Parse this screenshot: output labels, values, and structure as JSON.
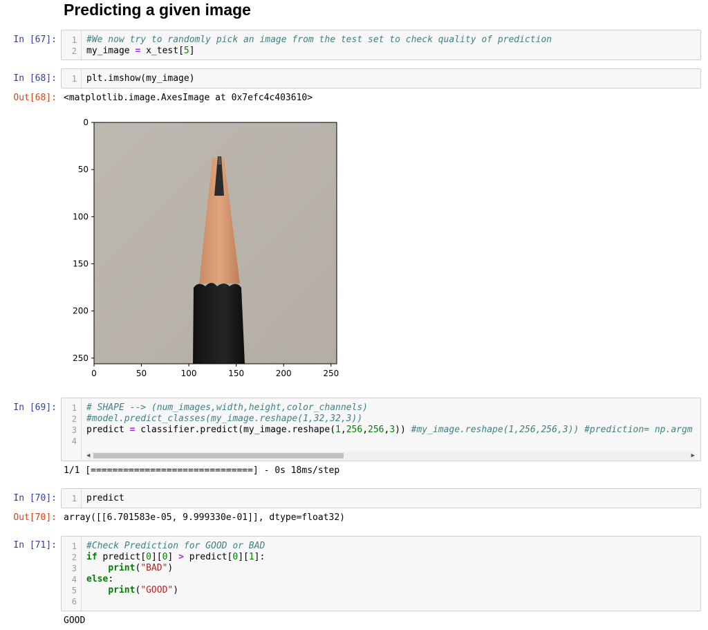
{
  "heading": "Predicting a given image",
  "cells": [
    {
      "prompt": "In [67]:",
      "lines": [
        [
          [
            "cm",
            "#We now try to randomly pick an image from the test set to check quality of prediction"
          ]
        ],
        [
          [
            "",
            "my_image "
          ],
          [
            "op",
            "="
          ],
          [
            "",
            " x_test["
          ],
          [
            "num",
            "5"
          ],
          [
            "",
            "]"
          ]
        ]
      ]
    },
    {
      "prompt": "In [68]:",
      "lines": [
        [
          [
            "",
            "plt.imshow(my_image)"
          ]
        ]
      ]
    },
    {
      "prompt": "In [69]:",
      "lines": [
        [
          [
            "cm",
            "# SHAPE --> (num_images,width,height,color_channels)"
          ]
        ],
        [
          [
            "cm",
            "#model.predict_classes(my_image.reshape(1,32,32,3))"
          ]
        ],
        [
          [
            "",
            "predict "
          ],
          [
            "op",
            "="
          ],
          [
            "",
            " classifier.predict(my_image.reshape("
          ],
          [
            "num",
            "1"
          ],
          [
            "",
            ","
          ],
          [
            "num",
            "256"
          ],
          [
            "",
            ","
          ],
          [
            "num",
            "256"
          ],
          [
            "",
            ","
          ],
          [
            "num",
            "3"
          ],
          [
            "",
            "))"
          ],
          [
            "",
            " "
          ],
          [
            "cm",
            "#my_image.reshape(1,256,256,3)) #prediction= np.argm"
          ]
        ],
        [
          [
            "",
            ""
          ]
        ]
      ]
    },
    {
      "prompt": "In [70]:",
      "lines": [
        [
          [
            "",
            "predict"
          ]
        ]
      ]
    },
    {
      "prompt": "In [71]:",
      "lines": [
        [
          [
            "cm",
            "#Check Prediction for GOOD or BAD"
          ]
        ],
        [
          [
            "kw",
            "if"
          ],
          [
            "",
            " predict["
          ],
          [
            "num",
            "0"
          ],
          [
            "",
            "]["
          ],
          [
            "num",
            "0"
          ],
          [
            "",
            "] "
          ],
          [
            "op",
            ">"
          ],
          [
            "",
            " predict["
          ],
          [
            "num",
            "0"
          ],
          [
            "",
            "]["
          ],
          [
            "num",
            "1"
          ],
          [
            "",
            "]:"
          ]
        ],
        [
          [
            "",
            "    "
          ],
          [
            "kw",
            "print"
          ],
          [
            "",
            "("
          ],
          [
            "str",
            "\"BAD\""
          ],
          [
            "",
            ")"
          ]
        ],
        [
          [
            "kw",
            "else"
          ],
          [
            "",
            ":"
          ]
        ],
        [
          [
            "",
            "    "
          ],
          [
            "kw",
            "print"
          ],
          [
            "",
            "("
          ],
          [
            "str",
            "\"GOOD\""
          ],
          [
            "",
            ")"
          ]
        ],
        [
          [
            "",
            ""
          ]
        ]
      ]
    }
  ],
  "outputs": {
    "out68_prompt": "Out[68]:",
    "out68_text": "<matplotlib.image.AxesImage at 0x7efc4c403610>",
    "out69_text": "1/1 [==============================] - 0s 18ms/step",
    "out70_prompt": "Out[70]:",
    "out70_text": "array([[6.701583e-05, 9.999330e-01]], dtype=float32)",
    "out71_text": "GOOD"
  },
  "plot": {
    "yticks": [
      "0",
      "50",
      "100",
      "150",
      "200",
      "250"
    ],
    "xticks": [
      "0",
      "50",
      "100",
      "150",
      "200",
      "250"
    ]
  },
  "colors": {
    "in_prompt": "#303f9f",
    "out_prompt": "#d84315",
    "comment": "#408080",
    "keyword": "#008000",
    "string": "#ba2121"
  }
}
